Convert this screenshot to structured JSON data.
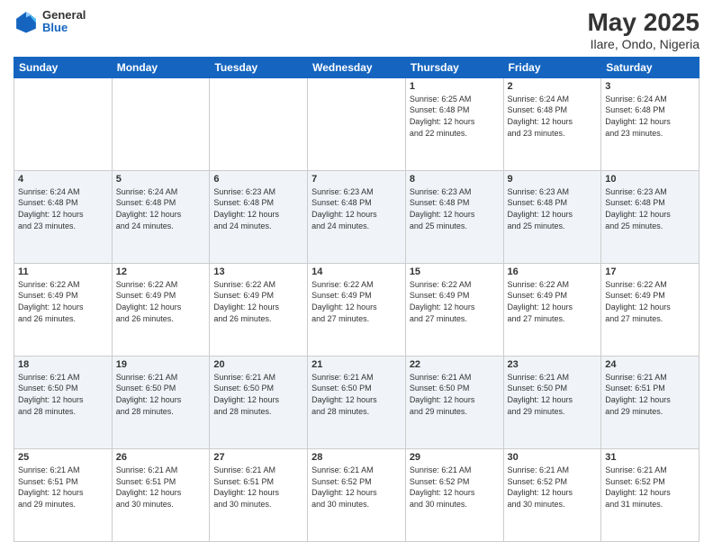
{
  "logo": {
    "general": "General",
    "blue": "Blue"
  },
  "title": "May 2025",
  "location": "Ilare, Ondo, Nigeria",
  "headers": [
    "Sunday",
    "Monday",
    "Tuesday",
    "Wednesday",
    "Thursday",
    "Friday",
    "Saturday"
  ],
  "weeks": [
    [
      {
        "day": "",
        "info": ""
      },
      {
        "day": "",
        "info": ""
      },
      {
        "day": "",
        "info": ""
      },
      {
        "day": "",
        "info": ""
      },
      {
        "day": "1",
        "info": "Sunrise: 6:25 AM\nSunset: 6:48 PM\nDaylight: 12 hours\nand 22 minutes."
      },
      {
        "day": "2",
        "info": "Sunrise: 6:24 AM\nSunset: 6:48 PM\nDaylight: 12 hours\nand 23 minutes."
      },
      {
        "day": "3",
        "info": "Sunrise: 6:24 AM\nSunset: 6:48 PM\nDaylight: 12 hours\nand 23 minutes."
      }
    ],
    [
      {
        "day": "4",
        "info": "Sunrise: 6:24 AM\nSunset: 6:48 PM\nDaylight: 12 hours\nand 23 minutes."
      },
      {
        "day": "5",
        "info": "Sunrise: 6:24 AM\nSunset: 6:48 PM\nDaylight: 12 hours\nand 24 minutes."
      },
      {
        "day": "6",
        "info": "Sunrise: 6:23 AM\nSunset: 6:48 PM\nDaylight: 12 hours\nand 24 minutes."
      },
      {
        "day": "7",
        "info": "Sunrise: 6:23 AM\nSunset: 6:48 PM\nDaylight: 12 hours\nand 24 minutes."
      },
      {
        "day": "8",
        "info": "Sunrise: 6:23 AM\nSunset: 6:48 PM\nDaylight: 12 hours\nand 25 minutes."
      },
      {
        "day": "9",
        "info": "Sunrise: 6:23 AM\nSunset: 6:48 PM\nDaylight: 12 hours\nand 25 minutes."
      },
      {
        "day": "10",
        "info": "Sunrise: 6:23 AM\nSunset: 6:48 PM\nDaylight: 12 hours\nand 25 minutes."
      }
    ],
    [
      {
        "day": "11",
        "info": "Sunrise: 6:22 AM\nSunset: 6:49 PM\nDaylight: 12 hours\nand 26 minutes."
      },
      {
        "day": "12",
        "info": "Sunrise: 6:22 AM\nSunset: 6:49 PM\nDaylight: 12 hours\nand 26 minutes."
      },
      {
        "day": "13",
        "info": "Sunrise: 6:22 AM\nSunset: 6:49 PM\nDaylight: 12 hours\nand 26 minutes."
      },
      {
        "day": "14",
        "info": "Sunrise: 6:22 AM\nSunset: 6:49 PM\nDaylight: 12 hours\nand 27 minutes."
      },
      {
        "day": "15",
        "info": "Sunrise: 6:22 AM\nSunset: 6:49 PM\nDaylight: 12 hours\nand 27 minutes."
      },
      {
        "day": "16",
        "info": "Sunrise: 6:22 AM\nSunset: 6:49 PM\nDaylight: 12 hours\nand 27 minutes."
      },
      {
        "day": "17",
        "info": "Sunrise: 6:22 AM\nSunset: 6:49 PM\nDaylight: 12 hours\nand 27 minutes."
      }
    ],
    [
      {
        "day": "18",
        "info": "Sunrise: 6:21 AM\nSunset: 6:50 PM\nDaylight: 12 hours\nand 28 minutes."
      },
      {
        "day": "19",
        "info": "Sunrise: 6:21 AM\nSunset: 6:50 PM\nDaylight: 12 hours\nand 28 minutes."
      },
      {
        "day": "20",
        "info": "Sunrise: 6:21 AM\nSunset: 6:50 PM\nDaylight: 12 hours\nand 28 minutes."
      },
      {
        "day": "21",
        "info": "Sunrise: 6:21 AM\nSunset: 6:50 PM\nDaylight: 12 hours\nand 28 minutes."
      },
      {
        "day": "22",
        "info": "Sunrise: 6:21 AM\nSunset: 6:50 PM\nDaylight: 12 hours\nand 29 minutes."
      },
      {
        "day": "23",
        "info": "Sunrise: 6:21 AM\nSunset: 6:50 PM\nDaylight: 12 hours\nand 29 minutes."
      },
      {
        "day": "24",
        "info": "Sunrise: 6:21 AM\nSunset: 6:51 PM\nDaylight: 12 hours\nand 29 minutes."
      }
    ],
    [
      {
        "day": "25",
        "info": "Sunrise: 6:21 AM\nSunset: 6:51 PM\nDaylight: 12 hours\nand 29 minutes."
      },
      {
        "day": "26",
        "info": "Sunrise: 6:21 AM\nSunset: 6:51 PM\nDaylight: 12 hours\nand 30 minutes."
      },
      {
        "day": "27",
        "info": "Sunrise: 6:21 AM\nSunset: 6:51 PM\nDaylight: 12 hours\nand 30 minutes."
      },
      {
        "day": "28",
        "info": "Sunrise: 6:21 AM\nSunset: 6:52 PM\nDaylight: 12 hours\nand 30 minutes."
      },
      {
        "day": "29",
        "info": "Sunrise: 6:21 AM\nSunset: 6:52 PM\nDaylight: 12 hours\nand 30 minutes."
      },
      {
        "day": "30",
        "info": "Sunrise: 6:21 AM\nSunset: 6:52 PM\nDaylight: 12 hours\nand 30 minutes."
      },
      {
        "day": "31",
        "info": "Sunrise: 6:21 AM\nSunset: 6:52 PM\nDaylight: 12 hours\nand 31 minutes."
      }
    ]
  ]
}
